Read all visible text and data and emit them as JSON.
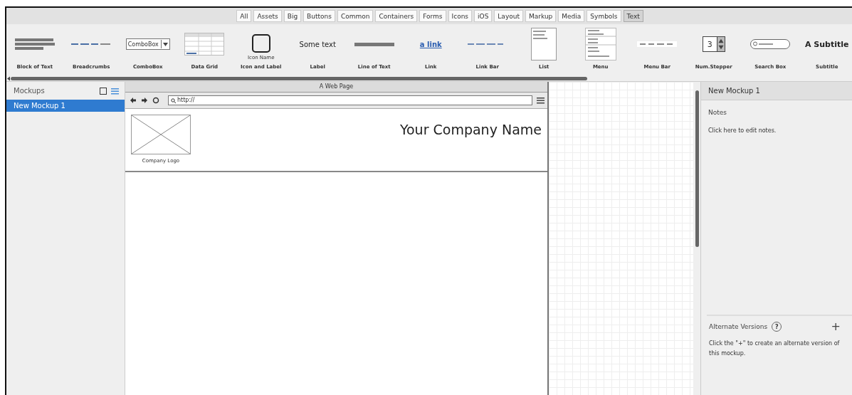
{
  "category_tabs": [
    {
      "label": "All",
      "selected": false
    },
    {
      "label": "Assets",
      "selected": false
    },
    {
      "label": "Big",
      "selected": false
    },
    {
      "label": "Buttons",
      "selected": false
    },
    {
      "label": "Common",
      "selected": false
    },
    {
      "label": "Containers",
      "selected": false
    },
    {
      "label": "Forms",
      "selected": false
    },
    {
      "label": "Icons",
      "selected": false
    },
    {
      "label": "iOS",
      "selected": false
    },
    {
      "label": "Layout",
      "selected": false
    },
    {
      "label": "Markup",
      "selected": false
    },
    {
      "label": "Media",
      "selected": false
    },
    {
      "label": "Symbols",
      "selected": false
    },
    {
      "label": "Text",
      "selected": true
    }
  ],
  "components": [
    {
      "kind": "block_text",
      "label": "Block of Text"
    },
    {
      "kind": "breadcrumbs",
      "label": "Breadcrumbs"
    },
    {
      "kind": "combobox",
      "label": "ComboBox",
      "preview_text": "ComboBox"
    },
    {
      "kind": "data_grid",
      "label": "Data Grid"
    },
    {
      "kind": "icon_label",
      "label": "Icon and Label",
      "preview_text": "Icon Name"
    },
    {
      "kind": "label",
      "label": "Label",
      "preview_text": "Some text"
    },
    {
      "kind": "line_text",
      "label": "Line of Text"
    },
    {
      "kind": "link",
      "label": "Link",
      "preview_text": "a link"
    },
    {
      "kind": "link_bar",
      "label": "Link Bar"
    },
    {
      "kind": "list",
      "label": "List"
    },
    {
      "kind": "menu",
      "label": "Menu"
    },
    {
      "kind": "menu_bar",
      "label": "Menu Bar"
    },
    {
      "kind": "num_stepper",
      "label": "Num.Stepper",
      "preview_text": "3"
    },
    {
      "kind": "search_box",
      "label": "Search Box"
    },
    {
      "kind": "subtitle",
      "label": "Subtitle",
      "preview_text": "A Subtitle"
    }
  ],
  "mockups_panel": {
    "title": "Mockups",
    "items": [
      {
        "label": "New Mockup 1",
        "selected": true
      }
    ]
  },
  "web_page": {
    "title": "A Web Page",
    "url": "http://",
    "logo_caption": "Company Logo",
    "company_name": "Your Company Name"
  },
  "inspector": {
    "title": "New Mockup 1",
    "notes_heading": "Notes",
    "notes_hint": "Click here to edit notes.",
    "versions_heading": "Alternate Versions",
    "help": "?",
    "add": "+",
    "versions_hint": "Click the \"+\" to create an alternate version of this mockup."
  }
}
